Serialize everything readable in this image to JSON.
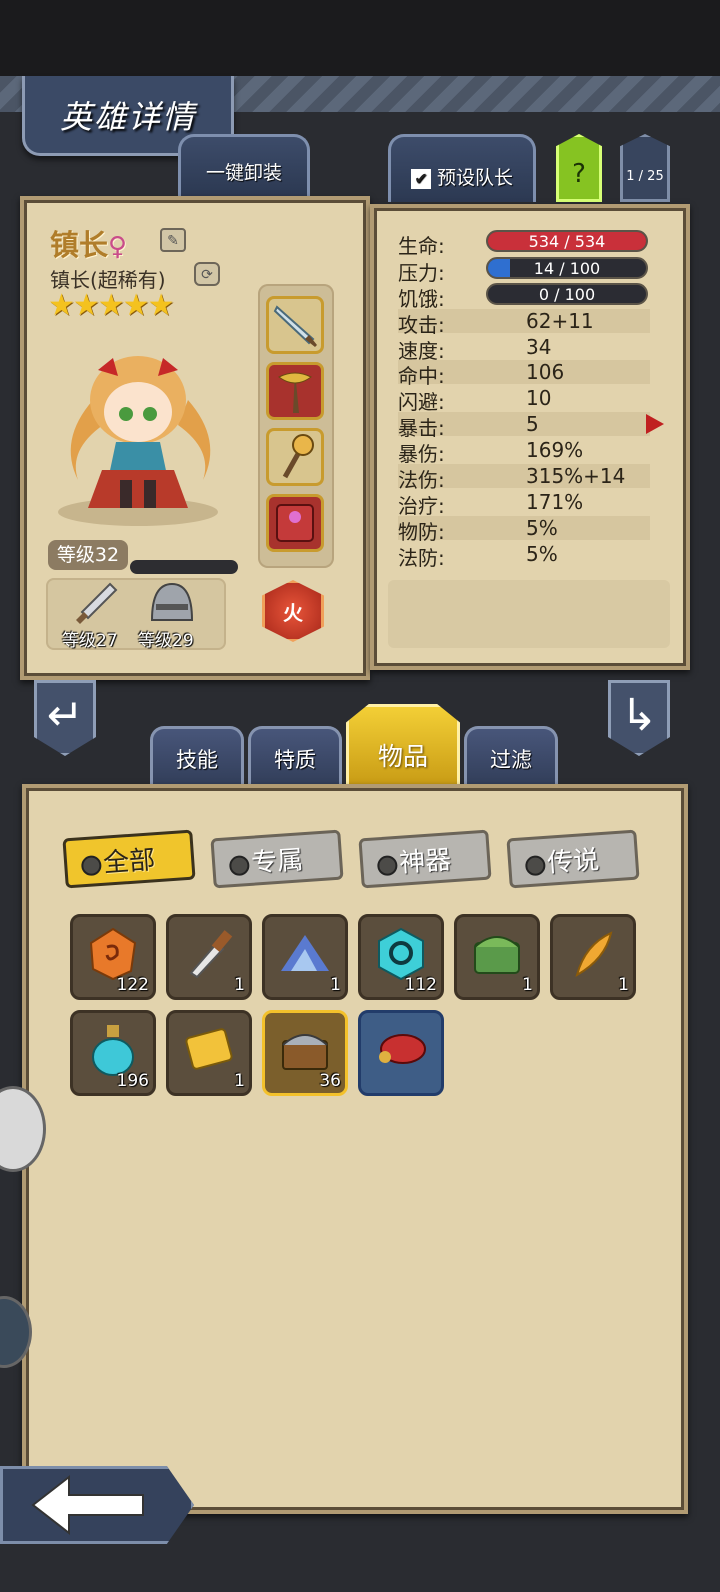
{
  "header": {
    "title": "英雄详情"
  },
  "top_buttons": {
    "unequip_all": "一键卸装",
    "preset_leader": "预设队长",
    "help": "?",
    "page": "1 / 25"
  },
  "hero": {
    "name": "镇长",
    "gender_symbol": "♀",
    "class": "镇长(超稀有)",
    "stars": "★★★★★",
    "level": "等级32",
    "element": "火",
    "gear": [
      {
        "label": "等级27",
        "icon": "sword-icon"
      },
      {
        "label": "等级29",
        "icon": "helmet-icon"
      }
    ],
    "equip_slots": [
      "sword-slot",
      "axe-slot",
      "staff-slot",
      "tome-slot"
    ]
  },
  "stats": {
    "hp": {
      "label": "生命:",
      "value": "534 / 534",
      "fill": 1.0,
      "color": "#c9303a"
    },
    "stress": {
      "label": "压力:",
      "value": "14 / 100",
      "fill": 0.14,
      "color": "#2f6fd0"
    },
    "hunger": {
      "label": "饥饿:",
      "value": "0 / 100",
      "fill": 0.0,
      "color": "#888"
    },
    "rows": [
      {
        "label": "攻击:",
        "value": "62+11"
      },
      {
        "label": "速度:",
        "value": "34"
      },
      {
        "label": "命中:",
        "value": "106"
      },
      {
        "label": "闪避:",
        "value": "10"
      },
      {
        "label": "暴击:",
        "value": "5"
      },
      {
        "label": "暴伤:",
        "value": "169%"
      },
      {
        "label": "法伤:",
        "value": "315%+14"
      },
      {
        "label": "治疗:",
        "value": "171%"
      },
      {
        "label": "物防:",
        "value": "5%"
      },
      {
        "label": "法防:",
        "value": "5%"
      }
    ]
  },
  "tabs": {
    "skills": "技能",
    "traits": "特质",
    "items": "物品",
    "filter": "过滤"
  },
  "filters": {
    "all": "全部",
    "exclusive": "专属",
    "artifact": "神器",
    "legend": "传说"
  },
  "items": [
    {
      "icon": "rune-stone-icon",
      "count": "122"
    },
    {
      "icon": "knife-icon",
      "count": "1"
    },
    {
      "icon": "crystal-pile-icon",
      "count": "1"
    },
    {
      "icon": "cyan-rune-icon",
      "count": "112"
    },
    {
      "icon": "green-chest-icon",
      "count": "1"
    },
    {
      "icon": "golden-feather-icon",
      "count": "1"
    },
    {
      "icon": "potion-icon",
      "count": "196"
    },
    {
      "icon": "ticket-icon",
      "count": "1"
    },
    {
      "icon": "treasure-chest-icon",
      "count": "36"
    },
    {
      "icon": "red-scarf-icon",
      "count": ""
    }
  ]
}
